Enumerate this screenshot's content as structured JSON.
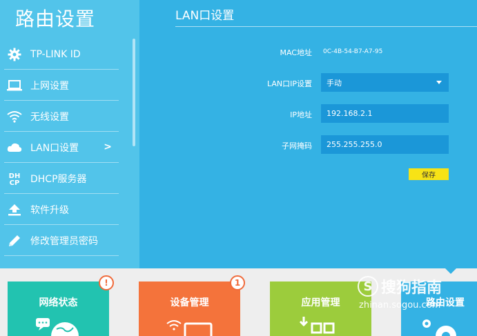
{
  "sidebar": {
    "title": "路由设置",
    "items": [
      {
        "label": "TP-LINK ID",
        "icon": "gear-icon"
      },
      {
        "label": "上网设置",
        "icon": "laptop-icon"
      },
      {
        "label": "无线设置",
        "icon": "wifi-icon"
      },
      {
        "label": "LAN口设置",
        "icon": "cloud-icon",
        "arrow": ">"
      },
      {
        "label": "DHCP服务器",
        "icon": "dhcp-icon",
        "icon_text": "DH CP"
      },
      {
        "label": "软件升级",
        "icon": "upload-icon"
      },
      {
        "label": "修改管理员密码",
        "icon": "pencil-icon"
      }
    ]
  },
  "main": {
    "title": "LAN口设置",
    "mac_label": "MAC地址",
    "mac_value": "0C-4B-54-B7-A7-95",
    "lan_ip_label": "LAN口IP设置",
    "lan_ip_mode": "手动",
    "ip_label": "IP地址",
    "ip_value": "192.168.2.1",
    "mask_label": "子网掩码",
    "mask_value": "255.255.255.0",
    "save_label": "保存"
  },
  "tiles": [
    {
      "label": "网络状态",
      "badge": "!",
      "icon": "globe-chat-icon",
      "color": "#22c3b0"
    },
    {
      "label": "设备管理",
      "badge": "1",
      "icon": "monitor-wifi-icon",
      "color": "#f4733b"
    },
    {
      "label": "应用管理",
      "icon": "app-grid-icon",
      "color": "#9ccc3c"
    },
    {
      "label": "路由设置",
      "icon": "gear-settings-icon",
      "color": "#34b2e4"
    }
  ],
  "watermark": {
    "brand": "搜狗指南",
    "url": "zhinan.sogou.com"
  },
  "colors": {
    "sidebar": "#52c4ea",
    "main": "#34b2e4",
    "field": "#1b97d8",
    "save": "#f7e316",
    "badge": "#f06a3a"
  }
}
